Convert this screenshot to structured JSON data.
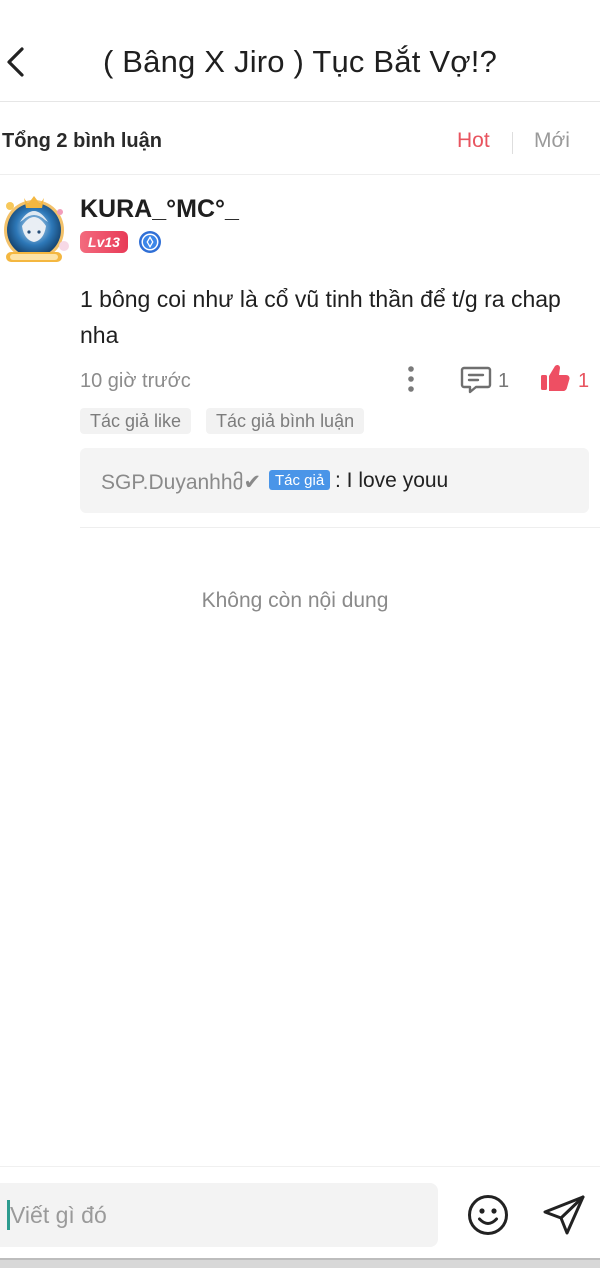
{
  "header": {
    "title": "( Bâng X Jiro ) Tục Bắt Vợ!?",
    "back_icon": "chevron-left-icon"
  },
  "summary": {
    "count_label": "Tổng 2 bình luận",
    "sort_hot": "Hot",
    "sort_new": "Mới",
    "active_sort": "Hot",
    "accent_color": "#e8545f"
  },
  "comment": {
    "username": "KURA_°MC°_",
    "level": "Lv13",
    "text": "1 bông coi như là cổ vũ tinh thần để t/g ra chap nha",
    "time": "10 giờ trước",
    "reply_count": "1",
    "like_count": "1",
    "tags": [
      "Tác giả like",
      "Tác giả bình luận"
    ],
    "reply": {
      "name": "SGP.Duyanhhმ✔",
      "badge": "Tác giả",
      "text": ": I love youu"
    }
  },
  "end_text": "Không còn nội dung",
  "input": {
    "placeholder": "Viết gì đó"
  },
  "icons": {
    "emoji": "smiley-icon",
    "send": "send-icon",
    "more": "more-vertical-icon",
    "reply": "comment-icon",
    "like": "thumbs-up-icon"
  }
}
